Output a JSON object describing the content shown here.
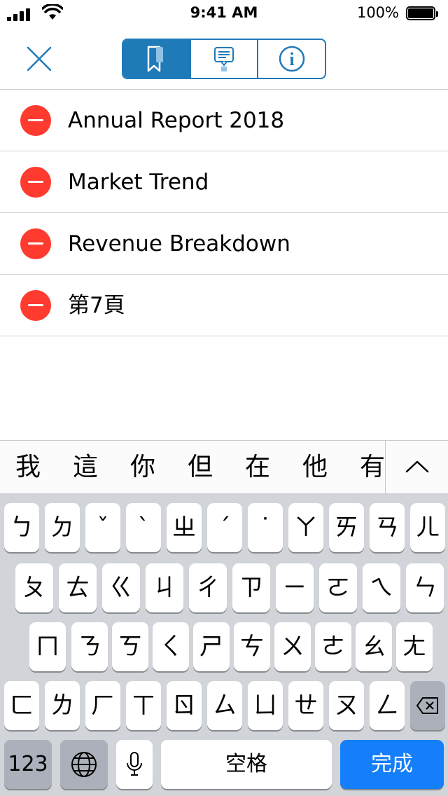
{
  "status_bar": {
    "time": "9:41 AM",
    "battery_percent": "100%"
  },
  "toolbar": {
    "close_icon": "close-x-icon",
    "segments": [
      {
        "icon": "bookmark-icon",
        "selected": true
      },
      {
        "icon": "comment-icon",
        "selected": false
      },
      {
        "icon": "info-icon",
        "selected": false
      }
    ],
    "info_glyph": "i",
    "accent_color": "#1f7ab8"
  },
  "bookmarks": [
    {
      "label": "Annual Report 2018"
    },
    {
      "label": "Market Trend"
    },
    {
      "label": "Revenue Breakdown"
    },
    {
      "label": "第7頁"
    }
  ],
  "delete_color": "#ff3b30",
  "candidates": [
    "我",
    "這",
    "你",
    "但",
    "在",
    "他",
    "有"
  ],
  "keyboard": {
    "row1": [
      "ㄅ",
      "ㄉ",
      "ˇ",
      "ˋ",
      "ㄓ",
      "ˊ",
      "˙",
      "ㄚ",
      "ㄞ",
      "ㄢ",
      "ㄦ"
    ],
    "row2": [
      "ㄆ",
      "ㄊ",
      "ㄍ",
      "ㄐ",
      "ㄔ",
      "ㄗ",
      "ㄧ",
      "ㄛ",
      "ㄟ",
      "ㄣ"
    ],
    "row3": [
      "ㄇ",
      "ㄋ",
      "ㄎ",
      "ㄑ",
      "ㄕ",
      "ㄘ",
      "ㄨ",
      "ㄜ",
      "ㄠ",
      "ㄤ"
    ],
    "row4": [
      "ㄈ",
      "ㄌ",
      "ㄏ",
      "ㄒ",
      "ㄖ",
      "ㄙ",
      "ㄩ",
      "ㄝ",
      "ㄡ",
      "ㄥ"
    ],
    "numbers_label": "123",
    "space_label": "空格",
    "done_label": "完成",
    "done_color": "#147efb"
  }
}
